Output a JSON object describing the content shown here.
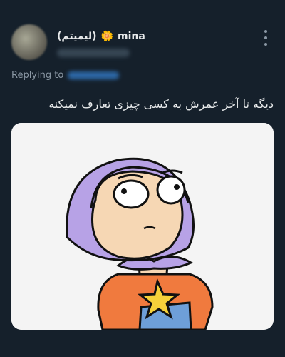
{
  "tweet": {
    "author_name": "mina",
    "author_badge": "(لیمیتم)",
    "flower_icon": "🌼",
    "replying_label": "Replying to",
    "text": "دیگه تا آخر عمرش به کسی چیزی تعارف نمیکنه"
  },
  "colors": {
    "background": "#15202b",
    "text_primary": "#e7e9ea",
    "text_secondary": "#8b98a5",
    "link": "#2f6fb3"
  },
  "icons": [
    "flower-icon",
    "more-options-icon"
  ]
}
